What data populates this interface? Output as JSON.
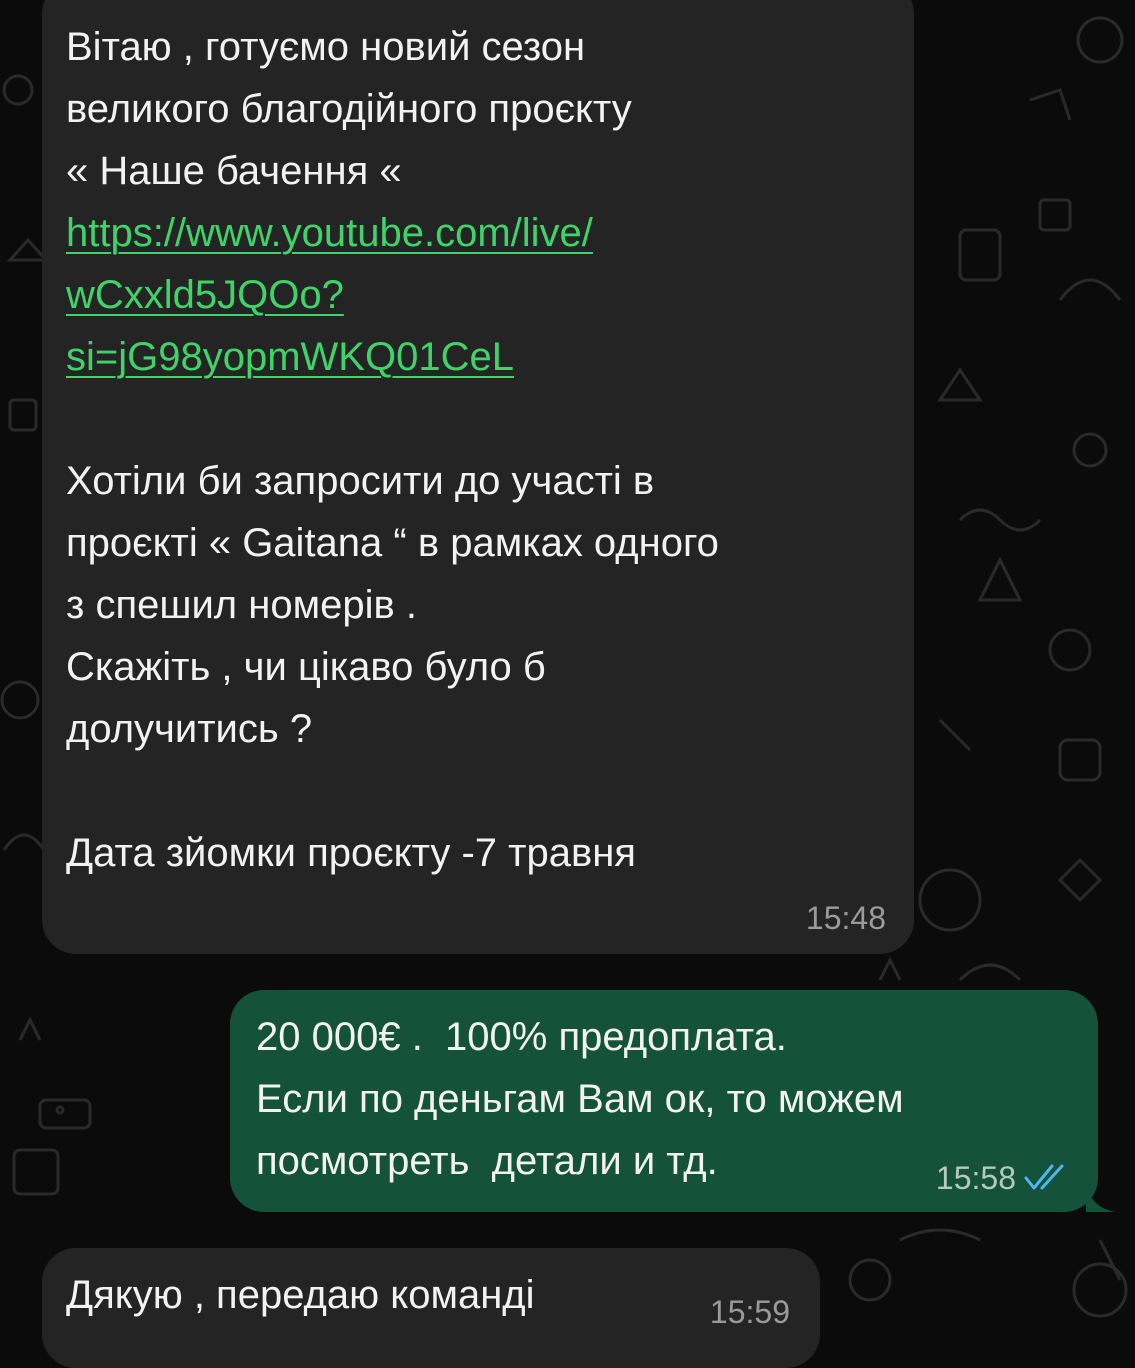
{
  "messages": [
    {
      "direction": "incoming",
      "lines": [
        "Вітаю , готуємо новий сезон",
        "великого благодійного проєкту",
        "« Наше бачення «"
      ],
      "link_lines": [
        "https://www.youtube.com/live/",
        "wCxxld5JQOo?",
        "si=jG98yopmWKQ01CeL"
      ],
      "lines_2": [
        "Хотіли би запросити до участі в",
        "проєкті « Gaitana “ в рамках одного",
        "з спешил номерів .",
        "Скажіть , чи цікаво було б",
        "долучитись ?"
      ],
      "lines_3": [
        "Дата зйомки проєкту -7 травня"
      ],
      "time": "15:48"
    },
    {
      "direction": "outgoing",
      "lines": [
        "20 000€ .  100% предоплата.",
        "Если по деньгам Вам ок, то можем",
        "посмотреть  детали и тд."
      ],
      "time": "15:58",
      "status_icon": "double-check-read-icon",
      "status_color": "#4fb6f0"
    },
    {
      "direction": "incoming",
      "lines": [
        "Дякую , передаю команді"
      ],
      "time": "15:59"
    }
  ],
  "colors": {
    "background": "#0b0b0b",
    "incoming_bubble": "#242424",
    "outgoing_bubble": "#14523b",
    "link": "#3fd36a"
  }
}
